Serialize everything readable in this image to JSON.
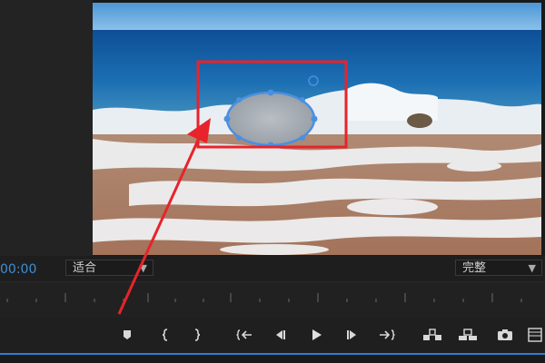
{
  "program_monitor": {
    "timecode": "00:00",
    "fit_dropdown": {
      "value": "适合"
    },
    "quality_dropdown": {
      "value": "完整"
    }
  },
  "transport_controls": [
    {
      "name": "add-marker-icon"
    },
    {
      "name": "mark-in-icon"
    },
    {
      "name": "mark-out-icon"
    },
    {
      "name": "go-to-in-icon"
    },
    {
      "name": "step-back-icon"
    },
    {
      "name": "play-icon"
    },
    {
      "name": "step-forward-icon"
    },
    {
      "name": "go-to-out-icon"
    },
    {
      "name": "lift-icon"
    },
    {
      "name": "extract-icon"
    },
    {
      "name": "export-frame-icon"
    },
    {
      "name": "comparison-view-icon"
    }
  ],
  "annotation": {
    "highlight_color": "#e8232b",
    "mask_color": "#4a8fe0"
  }
}
